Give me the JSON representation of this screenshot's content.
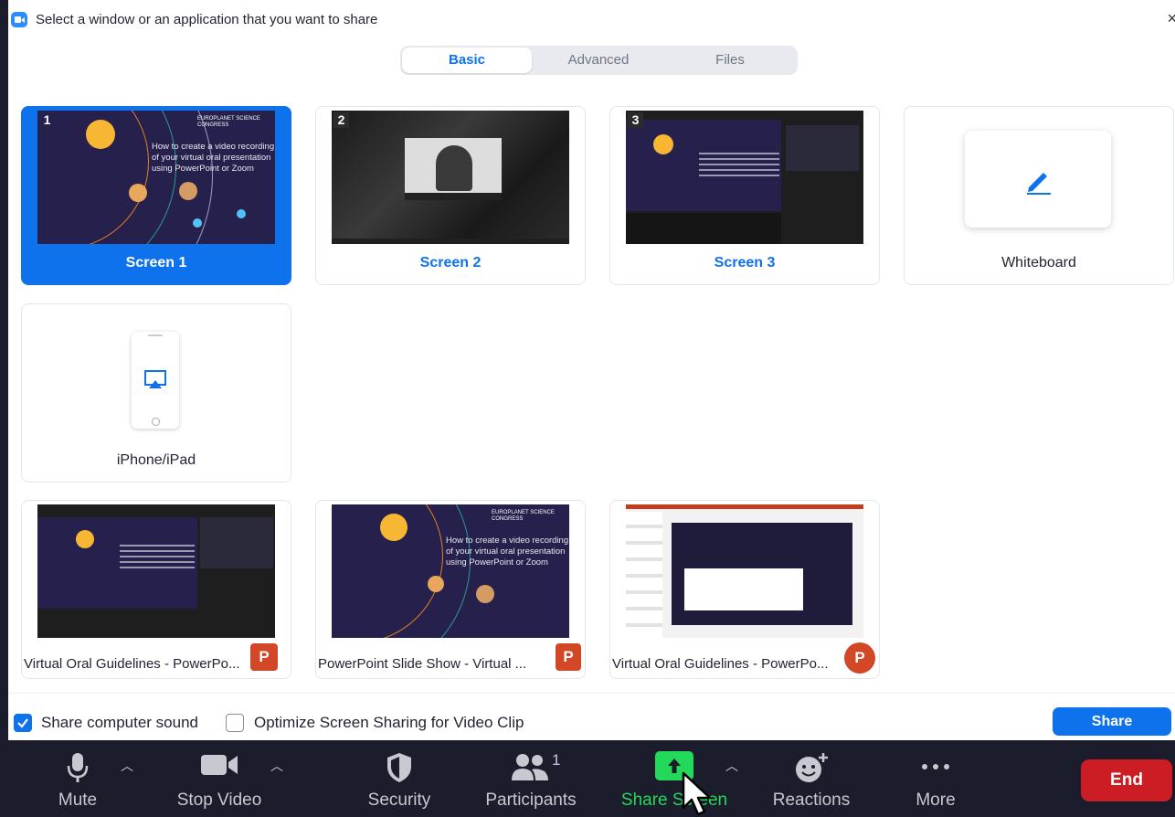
{
  "dialog": {
    "title": "Select a window or an application that you want to share",
    "close_glyph": "×",
    "tabs": [
      {
        "label": "Basic",
        "active": true
      },
      {
        "label": "Advanced",
        "active": false
      },
      {
        "label": "Files",
        "active": false
      }
    ],
    "screens": [
      {
        "label": "Screen 1",
        "number": "1",
        "selected": true,
        "slide_title": "How to create a video recording of your virtual oral presentation using PowerPoint or Zoom",
        "logo": "EUROPLANET SCIENCE CONGRESS"
      },
      {
        "label": "Screen 2",
        "number": "2",
        "selected": false
      },
      {
        "label": "Screen 3",
        "number": "3",
        "selected": false
      }
    ],
    "whiteboard": {
      "label": "Whiteboard",
      "icon": "pen-icon"
    },
    "iphone": {
      "label": "iPhone/iPad",
      "icon": "airplay-icon"
    },
    "apps": [
      {
        "label": "Virtual Oral Guidelines - PowerPo...",
        "icon": "powerpoint-show-icon"
      },
      {
        "label": "PowerPoint Slide Show  -  Virtual ...",
        "icon": "powerpoint-doc-icon"
      },
      {
        "label": "Virtual Oral Guidelines - PowerPo...",
        "icon": "powerpoint-round-icon"
      }
    ],
    "ppt_letter": "P",
    "footer": {
      "share_sound": {
        "label": "Share computer sound",
        "checked": true
      },
      "optimize": {
        "label": "Optimize Screen Sharing for Video Clip",
        "checked": false
      },
      "share_button": "Share"
    }
  },
  "toolbar": {
    "mute": "Mute",
    "stop_video": "Stop Video",
    "security": "Security",
    "participants": "Participants",
    "participants_count": "1",
    "share_screen": "Share Screen",
    "reactions": "Reactions",
    "more": "More",
    "end": "End",
    "colors": {
      "share": "#23d959",
      "end": "#cc1d24",
      "accent": "#0e72ed"
    }
  }
}
